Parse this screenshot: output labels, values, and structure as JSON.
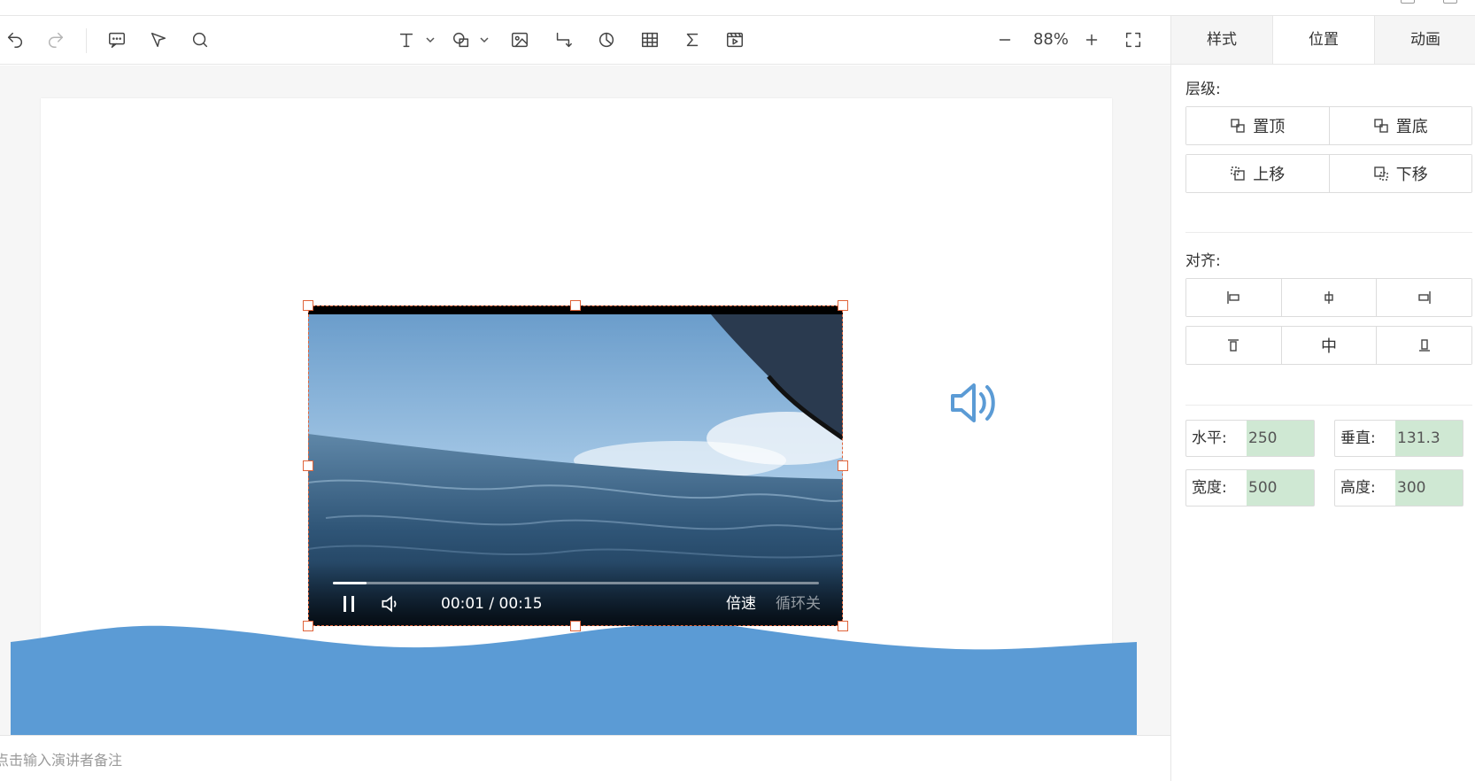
{
  "toolbar": {
    "undo_icon": "undo-icon",
    "redo_icon": "redo-icon",
    "comment_icon": "comment-icon",
    "select_icon": "pointer-icon",
    "search_icon": "search-icon",
    "text_icon": "text-icon",
    "shape_icon": "shape-icon",
    "image_icon": "image-icon",
    "connector_icon": "connector-icon",
    "chart_icon": "pie-chart-icon",
    "table_icon": "table-icon",
    "formula_icon": "sigma-icon",
    "media_icon": "video-icon",
    "zoom_out_icon": "minus-icon",
    "zoom_in_icon": "plus-icon",
    "fullscreen_icon": "fullscreen-icon",
    "zoom_level": "88%"
  },
  "video": {
    "current_time": "00:01",
    "duration": "00:15",
    "time_display": "00:01 / 00:15",
    "progress": 0.07,
    "speed_label": "倍速",
    "loop_label": "循环关"
  },
  "notes": {
    "placeholder": "点击输入演讲者备注"
  },
  "panel": {
    "tabs": [
      {
        "label": "样式",
        "active": false
      },
      {
        "label": "位置",
        "active": true
      },
      {
        "label": "动画",
        "active": false
      }
    ],
    "layer": {
      "title": "层级:",
      "bring_to_front": "置顶",
      "send_to_back": "置底",
      "move_up": "上移",
      "move_down": "下移"
    },
    "align": {
      "title": "对齐:",
      "middle_label": "中"
    },
    "position": {
      "horizontal_label": "水平:",
      "horizontal_value": "250",
      "vertical_label": "垂直:",
      "vertical_value": "131.3",
      "width_label": "宽度:",
      "width_value": "500",
      "height_label": "高度:",
      "height_value": "300"
    }
  },
  "colors": {
    "selection": "#e0643a",
    "wave": "#5b9bd5",
    "speaker": "#5b9bd5",
    "input_bg": "#cfe8d3"
  }
}
